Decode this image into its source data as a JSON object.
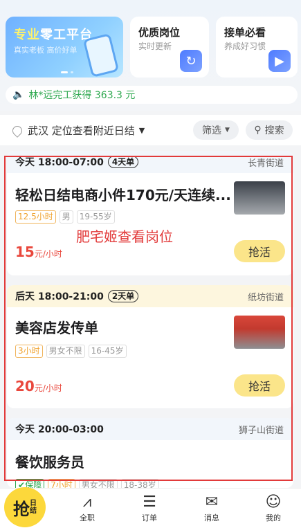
{
  "banner": {
    "title_a": "专业",
    "title_b": "零工平台",
    "subtitle": "真实老板 高价好单"
  },
  "cards": [
    {
      "title": "优质岗位",
      "subtitle": "实时更新",
      "icon": "refresh-icon"
    },
    {
      "title": "接单必看",
      "subtitle": "养成好习惯",
      "icon": "video-icon"
    }
  ],
  "notice": {
    "text": "林*远完工获得 363.3 元"
  },
  "filter": {
    "location": "武汉 定位查看附近日结",
    "filter_label": "筛选",
    "search_label": "搜索"
  },
  "jobs": [
    {
      "date": "今天 18:00-07:00",
      "days": "4天单",
      "street": "长青街道",
      "title": "轻松日结电商小件170元/天连续...",
      "tags": [
        "12.5小时",
        "男",
        "19-55岁"
      ],
      "price": "15",
      "unit": "元/小时",
      "button": "抢活"
    },
    {
      "date": "后天 18:00-21:00",
      "days": "2天单",
      "street": "纸坊街道",
      "title": "美容店发传单",
      "tags": [
        "3小时",
        "男女不限",
        "16-45岁"
      ],
      "price": "20",
      "unit": "元/小时",
      "button": "抢活"
    },
    {
      "date": "今天 20:00-03:00",
      "street": "狮子山街道",
      "title": "餐饮服务员",
      "tags": [
        "保障",
        "7小时",
        "男女不限",
        "18-38岁"
      ]
    }
  ],
  "overlay": {
    "text": "肥宅姬查看岗位"
  },
  "tabbar": {
    "grab_big": "抢",
    "grab_small": "日结",
    "items": [
      "全职",
      "订单",
      "消息",
      "我的"
    ]
  },
  "colors": {
    "accent": "#fcd83b",
    "price": "#e9473c",
    "highlight_border": "#e23a3a",
    "notice": "#2ea84f"
  }
}
